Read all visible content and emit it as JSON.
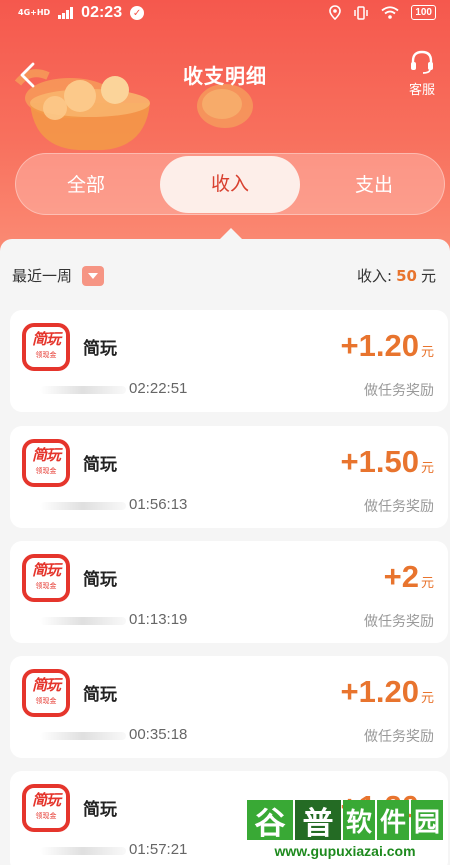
{
  "status_bar": {
    "network": "4G+HD",
    "time": "02:23",
    "battery": "100"
  },
  "header": {
    "title": "收支明细",
    "service_label": "客服"
  },
  "tabs": [
    {
      "label": "全部",
      "active": false
    },
    {
      "label": "收入",
      "active": true
    },
    {
      "label": "支出",
      "active": false
    }
  ],
  "filter": {
    "label": "最近一周",
    "income_label": "收入:",
    "income_amount": "50",
    "income_unit": "元"
  },
  "records": [
    {
      "app_name": "简玩",
      "icon_text": "简玩",
      "icon_sub": "领现金",
      "amount": "+1.20",
      "unit": "元",
      "time": "02:22:51",
      "desc": "做任务奖励"
    },
    {
      "app_name": "简玩",
      "icon_text": "简玩",
      "icon_sub": "领现金",
      "amount": "+1.50",
      "unit": "元",
      "time": "01:56:13",
      "desc": "做任务奖励"
    },
    {
      "app_name": "简玩",
      "icon_text": "简玩",
      "icon_sub": "领现金",
      "amount": "+2",
      "unit": "元",
      "time": "01:13:19",
      "desc": "做任务奖励"
    },
    {
      "app_name": "简玩",
      "icon_text": "简玩",
      "icon_sub": "领现金",
      "amount": "+1.20",
      "unit": "元",
      "time": "00:35:18",
      "desc": "做任务奖励"
    },
    {
      "app_name": "简玩",
      "icon_text": "简玩",
      "icon_sub": "领现金",
      "amount": "+1.20",
      "unit": "元",
      "time": "01:57:21",
      "desc": ""
    }
  ],
  "watermark": {
    "chars": [
      "谷",
      "普",
      "软",
      "件",
      "园"
    ],
    "url": "www.gupuxiazai.com"
  },
  "colors": {
    "header_top": "#f5584d",
    "accent_orange": "#e8742e",
    "active_tab_text": "#d8402f"
  }
}
